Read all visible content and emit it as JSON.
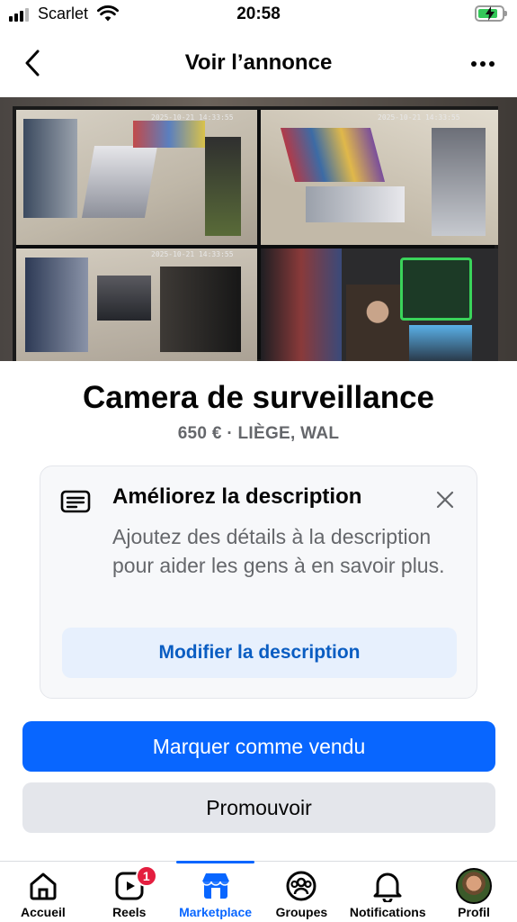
{
  "status_bar": {
    "carrier": "Scarlet",
    "time": "20:58",
    "battery_percent": 85
  },
  "header": {
    "title": "Voir l’annonce",
    "back_icon": "chevron-left-icon",
    "more_icon": "more-horizontal-icon"
  },
  "photo": {
    "timestamps": [
      "2025-10-21 14:33:55",
      "2025-10-21 14:33:55",
      "2025-10-21 14:33:55"
    ],
    "carousel": {
      "count": 3,
      "active_index": 2
    }
  },
  "listing": {
    "title": "Camera de surveillance",
    "meta": "650 € · LIÈGE, WAL"
  },
  "improve_card": {
    "title": "Améliorez la description",
    "text": "Ajoutez des détails à la description pour aider les gens à en savoir plus.",
    "button_label": "Modifier la description",
    "icon": "description-icon",
    "close_icon": "close-icon"
  },
  "actions": {
    "mark_sold_label": "Marquer comme vendu",
    "promote_label": "Promouvoir"
  },
  "bottom_nav": {
    "items": [
      {
        "label": "Accueil",
        "icon": "home-icon"
      },
      {
        "label": "Reels",
        "icon": "reels-icon",
        "badge": "1"
      },
      {
        "label": "Marketplace",
        "icon": "marketplace-icon",
        "active": true
      },
      {
        "label": "Groupes",
        "icon": "groups-icon"
      },
      {
        "label": "Notifications",
        "icon": "bell-icon"
      },
      {
        "label": "Profil",
        "icon": "avatar"
      }
    ]
  },
  "colors": {
    "primary": "#0866ff",
    "badge": "#e41e3f",
    "secondary_text": "#65676b",
    "link": "#0a5dc2"
  }
}
